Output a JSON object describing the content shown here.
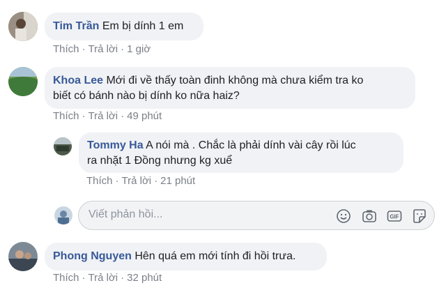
{
  "actions": {
    "like": "Thích",
    "reply": "Trả lời",
    "dot": "·"
  },
  "comments": [
    {
      "name": "Tim Trần",
      "text": "Em bị dính 1 em",
      "time": "1 giờ"
    },
    {
      "name": "Khoa Lee",
      "text_line1": "Mới đi về thấy toàn đinh không mà chưa kiểm tra ko",
      "text_line2": "biết có bánh nào bị dính ko nữa haiz?",
      "time": "49 phút"
    },
    {
      "name": "Tommy Ha",
      "text_line1": "A nói mà . Chắc là phải dính vài cây rồi lúc",
      "text_line2": "ra nhặt 1 Đồng nhưng kg xuể",
      "time": "21 phút"
    },
    {
      "name": "Phong Nguyen",
      "text": "Hên quá em mới tính đi hồi trưa.",
      "time": "32 phút"
    }
  ],
  "reply_input": {
    "placeholder": "Viết phản hồi..."
  },
  "icons": [
    "emoji-icon",
    "camera-icon",
    "gif-icon",
    "sticker-icon"
  ],
  "colors": {
    "name": "#385898",
    "bubble": "#f0f2f5",
    "meta": "#7a7f87"
  }
}
